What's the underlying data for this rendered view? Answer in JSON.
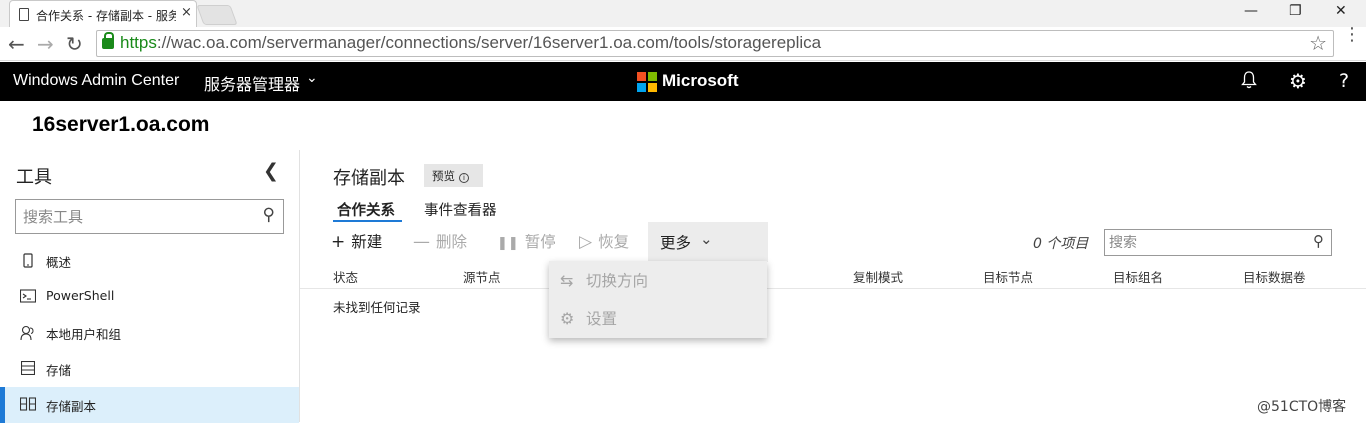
{
  "browser": {
    "tab_title": "合作关系 - 存储副本 - 服务",
    "tab_close": "×",
    "url_scheme": "https",
    "url_rest": "://wac.oa.com/servermanager/connections/server/16server1.oa.com/tools/storagereplica"
  },
  "header": {
    "brand": "Windows Admin Center",
    "context": "服务器管理器",
    "ms_text": "Microsoft",
    "colors": {
      "red": "#f25022",
      "green": "#7fba00",
      "blue": "#00a4ef",
      "yellow": "#ffb900"
    }
  },
  "server_name": "16server1.oa.com",
  "sidebar": {
    "title": "工具",
    "search_placeholder": "搜索工具",
    "items": [
      {
        "label": "概述",
        "icon": "phone-icon"
      },
      {
        "label": "PowerShell",
        "icon": "terminal-icon"
      },
      {
        "label": "本地用户和组",
        "icon": "users-icon"
      },
      {
        "label": "存储",
        "icon": "storage-icon"
      },
      {
        "label": "存储副本",
        "icon": "storage-replica-icon",
        "active": true
      }
    ]
  },
  "main": {
    "title": "存储副本",
    "preview_badge": "预览",
    "tabs": [
      "合作关系",
      "事件查看器"
    ],
    "commands": {
      "new": "新建",
      "delete": "删除",
      "pause": "暂停",
      "resume": "恢复",
      "more": "更多"
    },
    "item_count": "0 个项目",
    "search_placeholder": "搜索",
    "columns": [
      "状态",
      "源节点",
      "复制模式",
      "目标节点",
      "目标组名",
      "目标数据卷"
    ],
    "empty_message": "未找到任何记录",
    "dropdown": [
      "切换方向",
      "设置"
    ]
  },
  "watermark": "@51CTO博客"
}
